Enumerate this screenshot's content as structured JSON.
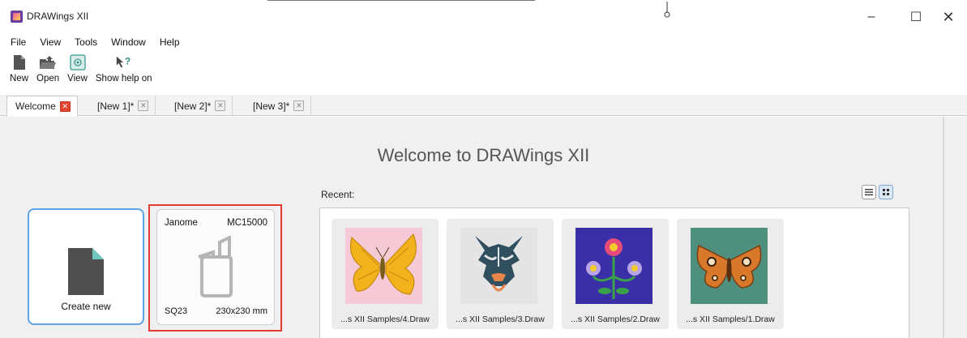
{
  "window": {
    "title": "DRAWings XII",
    "minimize": "–",
    "maximize": "☐",
    "close": "✕"
  },
  "menu": [
    "File",
    "View",
    "Tools",
    "Window",
    "Help"
  ],
  "toolbar": [
    {
      "label": "New",
      "icon": "new-file-icon"
    },
    {
      "label": "Open",
      "icon": "open-folder-icon"
    },
    {
      "label": "View",
      "icon": "view-icon"
    },
    {
      "label": "Show help on",
      "icon": "help-cursor-icon"
    }
  ],
  "tabs": [
    {
      "label": "Welcome",
      "active": true
    },
    {
      "label": "[New 1]*",
      "active": false
    },
    {
      "label": "[New 2]*",
      "active": false
    },
    {
      "label": "[New 3]*",
      "active": false
    }
  ],
  "welcome": {
    "title": "Welcome to DRAWings XII",
    "create_new": "Create new",
    "machine": {
      "brand": "Janome",
      "model": "MC15000",
      "hoop_code": "SQ23",
      "hoop_size": "230x230 mm"
    },
    "recent_label": "Recent:",
    "recent": [
      {
        "name": "...s XII Samples/4.Draw",
        "thumb": "yellow-butterfly"
      },
      {
        "name": "...s XII Samples/3.Draw",
        "thumb": "tribal-tiger"
      },
      {
        "name": "...s XII Samples/2.Draw",
        "thumb": "flowers-on-blue"
      },
      {
        "name": "...s XII Samples/1.Draw",
        "thumb": "brown-moth"
      }
    ]
  },
  "colors": {
    "accent_blue": "#5ea3e6",
    "highlight_red": "#e23c33",
    "tab_close_red": "#e2442f"
  }
}
